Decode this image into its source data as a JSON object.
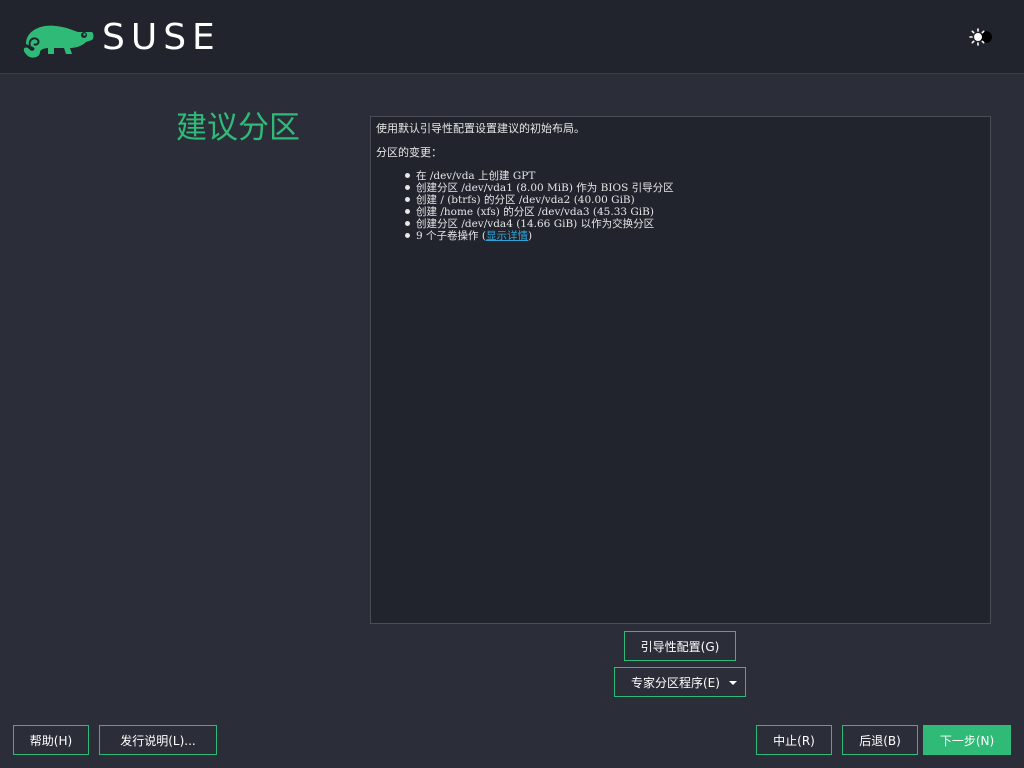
{
  "header": {
    "brand": "SUSE",
    "theme_toggle_icon": "sun-moon-icon"
  },
  "colors": {
    "accent": "#30ba78",
    "background": "#2b2e38",
    "header": "#21242d",
    "link": "#2ea4d9"
  },
  "page": {
    "title": "建议分区"
  },
  "summary": {
    "intro": "使用默认引导性配置设置建议的初始布局。",
    "changes_heading": "分区的变更：",
    "items": [
      "在 /dev/vda 上创建 GPT",
      "创建分区 /dev/vda1 (8.00 MiB) 作为 BIOS 引导分区",
      "创建 / (btrfs) 的分区 /dev/vda2 (40.00 GiB)",
      "创建 /home (xfs) 的分区 /dev/vda3 (45.33 GiB)",
      "创建分区 /dev/vda4 (14.66 GiB) 以作为交换分区"
    ],
    "subvol_prefix": "9 个子卷操作 (",
    "subvol_link": "显示详情",
    "subvol_suffix": ")"
  },
  "buttons": {
    "boot_config": "引导性配置(G)",
    "expert": "专家分区程序(E)",
    "help": "帮助(H)",
    "release_notes": "发行说明(L)...",
    "abort": "中止(R)",
    "back": "后退(B)",
    "next": "下一步(N)"
  }
}
